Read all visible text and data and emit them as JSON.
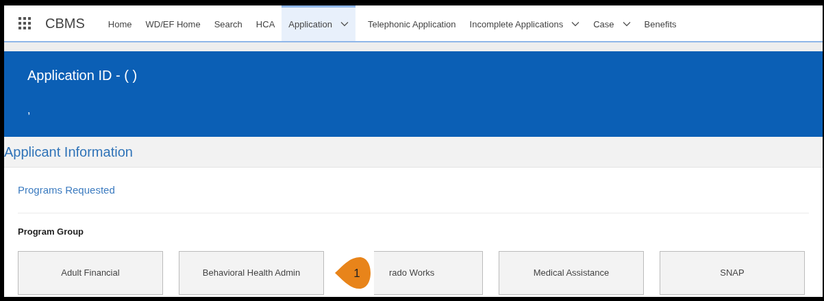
{
  "app_name": "CBMS",
  "nav": [
    {
      "label": "Home",
      "selected": false,
      "dropdown": false
    },
    {
      "label": "WD/EF Home",
      "selected": false,
      "dropdown": false
    },
    {
      "label": "Search",
      "selected": false,
      "dropdown": false
    },
    {
      "label": "HCA",
      "selected": false,
      "dropdown": false
    },
    {
      "label": "Application",
      "selected": true,
      "dropdown": true
    },
    {
      "label": "Telephonic Application",
      "selected": false,
      "dropdown": false
    },
    {
      "label": "Incomplete Applications",
      "selected": false,
      "dropdown": true
    },
    {
      "label": "Case",
      "selected": false,
      "dropdown": true
    },
    {
      "label": "Benefits",
      "selected": false,
      "dropdown": false
    }
  ],
  "header": {
    "title": "Application ID - ( )",
    "subtitle": ","
  },
  "section_title": "Applicant Information",
  "subsection_title": "Programs Requested",
  "group_label": "Program Group",
  "programs": [
    {
      "label": "Adult Financial",
      "kind": "full"
    },
    {
      "label": "Behavioral Health Admin",
      "kind": "full"
    },
    {
      "label": "rado Works",
      "kind": "partial"
    },
    {
      "label": "Medical Assistance",
      "kind": "full"
    },
    {
      "label": "SNAP",
      "kind": "full"
    }
  ],
  "callout": {
    "label": "1"
  }
}
